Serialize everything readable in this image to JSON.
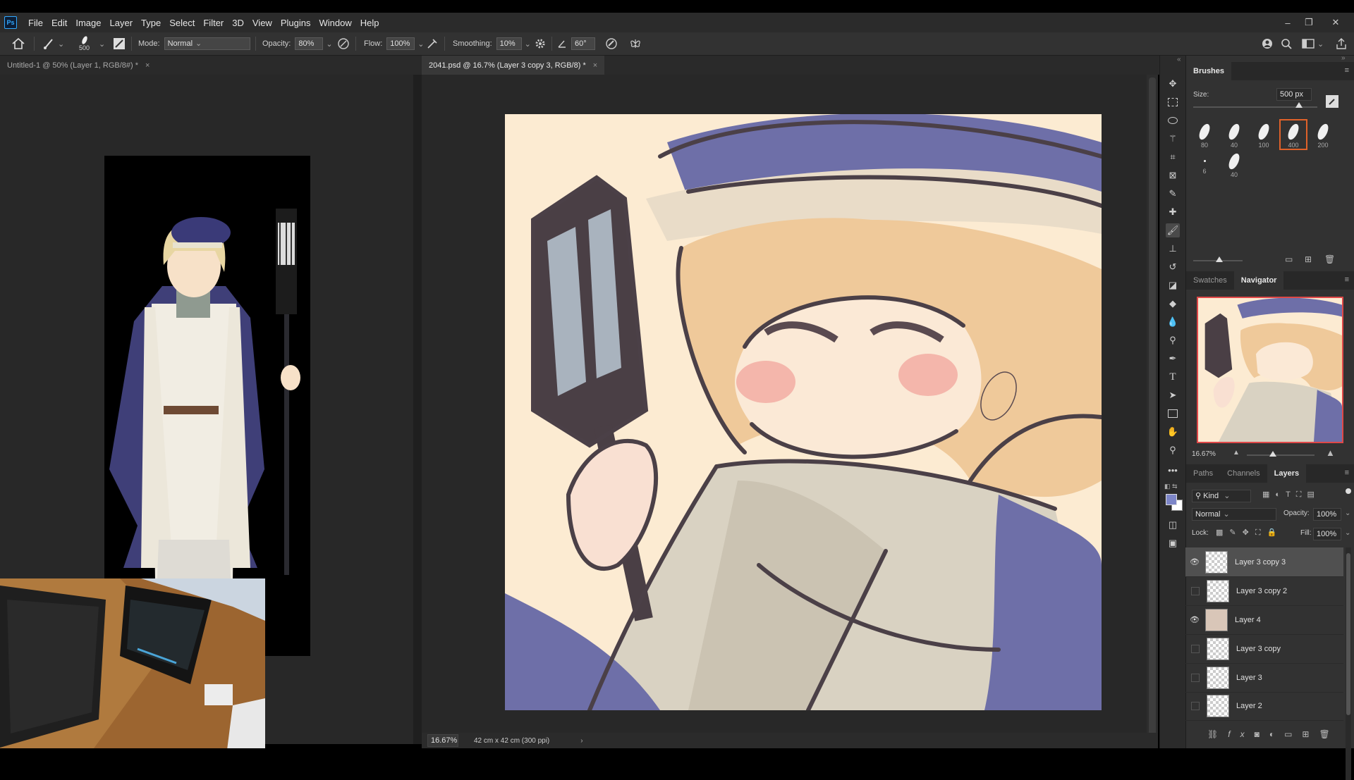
{
  "app": {
    "logo": "Ps"
  },
  "menubar": {
    "items": [
      "File",
      "Edit",
      "Image",
      "Layer",
      "Type",
      "Select",
      "Filter",
      "3D",
      "View",
      "Plugins",
      "Window",
      "Help"
    ]
  },
  "window_controls": {
    "minimize": "–",
    "restore": "❐",
    "close": "✕"
  },
  "options": {
    "brush_size": "500",
    "mode_label": "Mode:",
    "mode_value": "Normal",
    "opacity_label": "Opacity:",
    "opacity_value": "80%",
    "flow_label": "Flow:",
    "flow_value": "100%",
    "smoothing_label": "Smoothing:",
    "smoothing_value": "10%",
    "angle_value": "60°"
  },
  "tabs": {
    "left": {
      "label": "Untitled-1 @ 50% (Layer 1, RGB/8#) *",
      "close": "×"
    },
    "right": {
      "label": "2041.psd @ 16.7% (Layer 3 copy 3, RGB/8) *",
      "close": "×"
    }
  },
  "status": {
    "zoom": "16.67%",
    "doc_size": "42 cm x 42 cm (300 ppi)",
    "arrow": "›"
  },
  "brushes": {
    "title": "Brushes",
    "size_label": "Size:",
    "size_value": "500 px",
    "presets": [
      {
        "value": "80"
      },
      {
        "value": "40"
      },
      {
        "value": "100"
      },
      {
        "value": "400"
      },
      {
        "value": "200"
      },
      {
        "value": "6"
      },
      {
        "value": "40"
      }
    ]
  },
  "navigator": {
    "tabs": [
      "Swatches",
      "Navigator"
    ],
    "zoom": "16.67%"
  },
  "layers_panel": {
    "tabs": [
      "Paths",
      "Channels",
      "Layers"
    ],
    "kind_label": "Kind",
    "blend_mode": "Normal",
    "opacity_label": "Opacity:",
    "opacity_value": "100%",
    "lock_label": "Lock:",
    "fill_label": "Fill:",
    "fill_value": "100%",
    "layers": [
      {
        "name": "Layer 3 copy 3",
        "visible": true,
        "active": true
      },
      {
        "name": "Layer 3 copy 2",
        "visible": false,
        "active": false
      },
      {
        "name": "Layer 4",
        "visible": true,
        "active": false
      },
      {
        "name": "Layer 3 copy",
        "visible": false,
        "active": false
      },
      {
        "name": "Layer 3",
        "visible": false,
        "active": false
      },
      {
        "name": "Layer 2",
        "visible": false,
        "active": false
      }
    ]
  },
  "colors": {
    "foreground": "#7d86c8",
    "background": "#ffffff",
    "accent": "#31a8ff",
    "brush_selected": "#e0622a"
  }
}
